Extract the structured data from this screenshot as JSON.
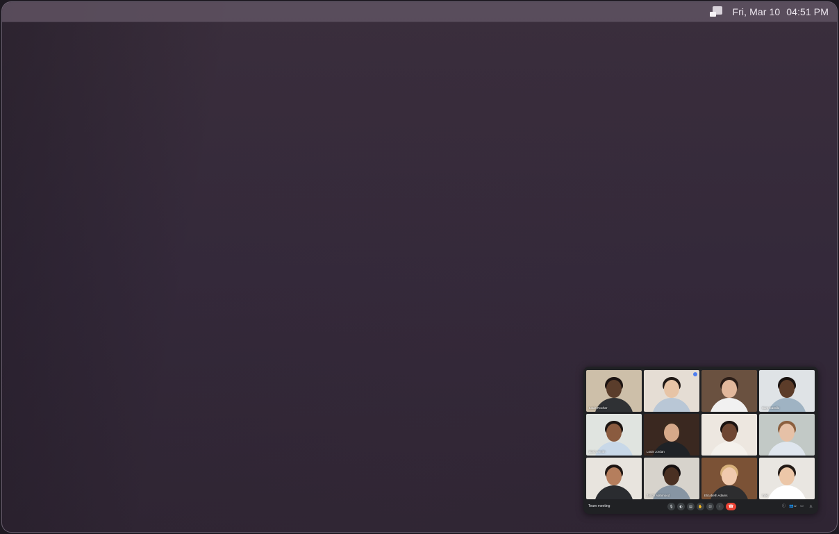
{
  "statusbar": {
    "date": "Fri, Mar 10",
    "time": "04:51 PM",
    "tray_icon": "window-switch-icon"
  },
  "meet": {
    "meeting_name": "Team meeting",
    "tiles": [
      {
        "name": "Louis Rocher",
        "bg": "#cdbfa9",
        "skin": "#5a3d2b",
        "hair": "#1c1412",
        "shirt": "#2f3134"
      },
      {
        "name": "",
        "bg": "#e5ddd4",
        "skin": "#e7c4a6",
        "hair": "#1f1815",
        "shirt": "#b9c7d6"
      },
      {
        "name": "",
        "bg": "#6a5140",
        "skin": "#e2b89c",
        "hair": "#2b1d17",
        "shirt": "#f1f1f1"
      },
      {
        "name": "Sam Castillo",
        "bg": "#dfe3e6",
        "skin": "#5c3c29",
        "hair": "#1a1310",
        "shirt": "#9fb3c3"
      },
      {
        "name": "Daria Smith",
        "bg": "#e0e4e0",
        "skin": "#8a5b3f",
        "hair": "#1b1411",
        "shirt": "#c8d8e8"
      },
      {
        "name": "Louis Jordan",
        "bg": "#3a2820",
        "skin": "#d6a98a",
        "hair": "#3b2a1f",
        "shirt": "#1f2226"
      },
      {
        "name": "",
        "bg": "#ede7e0",
        "skin": "#6e4632",
        "hair": "#1a1210",
        "shirt": "#f4f1ec"
      },
      {
        "name": "",
        "bg": "#c2c9c6",
        "skin": "#e6c1a7",
        "hair": "#8b5f3e",
        "shirt": "#dfe6ee"
      },
      {
        "name": "",
        "bg": "#e8e4de",
        "skin": "#b57e5d",
        "hair": "#1e1613",
        "shirt": "#2a2c30"
      },
      {
        "name": "Jacob Mahmood",
        "bg": "#d7d3cc",
        "skin": "#4a3022",
        "hair": "#151010",
        "shirt": "#8795a3"
      },
      {
        "name": "Elizabeth Adams",
        "bg": "#7b5236",
        "skin": "#f0c9ad",
        "hair": "#d7b07a",
        "shirt": "#2d2d2f"
      },
      {
        "name": "Yuki",
        "bg": "#e9e6e1",
        "skin": "#ecc7a8",
        "hair": "#231a16",
        "shirt": "#ffffff"
      }
    ],
    "controls": [
      {
        "icon": "microphone-icon",
        "glyph": "🎙"
      },
      {
        "icon": "camera-icon",
        "glyph": "◐"
      },
      {
        "icon": "captions-icon",
        "glyph": "▤"
      },
      {
        "icon": "raise-hand-icon",
        "glyph": "✋"
      },
      {
        "icon": "present-screen-icon",
        "glyph": "⊡"
      },
      {
        "icon": "more-options-icon",
        "glyph": "⋮"
      }
    ],
    "end_call_icon": "end-call-icon",
    "right_icons": [
      {
        "icon": "info-icon",
        "glyph": "ⓘ",
        "count": ""
      },
      {
        "icon": "people-icon",
        "glyph": "👥",
        "count": "12"
      },
      {
        "icon": "chat-icon",
        "glyph": "▭",
        "count": ""
      },
      {
        "icon": "activities-icon",
        "glyph": "◬",
        "count": ""
      }
    ]
  }
}
